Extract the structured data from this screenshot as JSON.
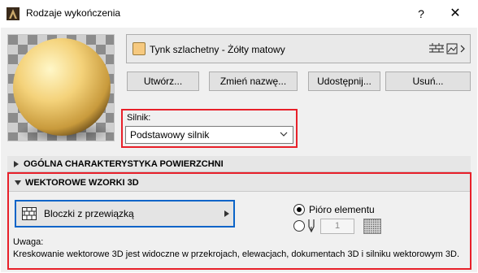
{
  "window": {
    "title": "Rodzaje wykończenia",
    "help_label": "?",
    "close_label": "✕"
  },
  "material": {
    "name": "Tynk szlachetny - Żółty matowy",
    "swatch_color": "#f6c97f"
  },
  "buttons": {
    "create": "Utwórz...",
    "rename": "Zmień nazwę...",
    "share": "Udostępnij...",
    "delete": "Usuń..."
  },
  "engine": {
    "label": "Silnik:",
    "value": "Podstawowy silnik"
  },
  "sections": {
    "general": "OGÓLNA CHARAKTERYSTYKA POWIERZCHNI",
    "vector": "WEKTOROWE WZORKI 3D"
  },
  "vector": {
    "pattern_name": "Bloczki z przewiązką",
    "pen_option_label": "Pióro elementu",
    "pen_number": "1",
    "note_title": "Uwaga:",
    "note_text": "Kreskowanie wektorowe 3D jest widoczne w przekrojach, elewacjach, dokumentach 3D i silniku wektorowym 3D."
  },
  "colors": {
    "highlight": "#e8202a",
    "focus": "#0a64c8"
  }
}
